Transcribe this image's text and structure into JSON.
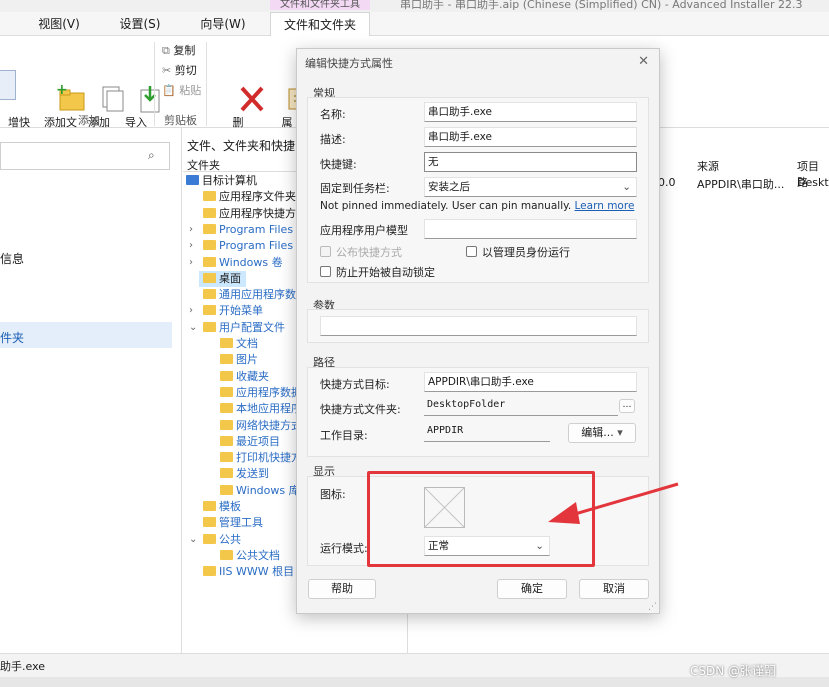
{
  "window": {
    "title": "串口助手 - 串口助手.aip (Chinese (Simplified) CN) - Advanced Installer 22.3",
    "context_tab_header": "文件和文件夹工具"
  },
  "menu": {
    "tabs": [
      "视图(V)",
      "设置(S)",
      "向导(W)",
      "文件和文件夹"
    ]
  },
  "ribbon": {
    "partial_left": "增快\n式·",
    "add_folder": "添加文\n件夹",
    "add_file": "添加\n文件",
    "import_file": "导入\n文件·",
    "group_add": "添加",
    "copy": "复制",
    "cut": "剪切",
    "paste": "粘贴",
    "group_clipboard": "剪贴板",
    "delete": "删\n除",
    "properties": "属\n性"
  },
  "left_pane": {
    "item_info": "信息",
    "item_files": "件夹"
  },
  "tree": {
    "header": "文件、文件夹和快捷",
    "col_folder": "文件夹",
    "items": [
      "目标计算机",
      "应用程序文件夹",
      "应用程序快捷方",
      "Program Files",
      "Program Files",
      "Windows 卷",
      "桌面",
      "通用应用程序数",
      "开始菜单",
      "用户配置文件",
      "文档",
      "图片",
      "收藏夹",
      "应用程序数据",
      "本地应用程序",
      "网络快捷方式",
      "最近项目",
      "打印机快捷方",
      "发送到",
      "Windows 库",
      "模板",
      "管理工具",
      "公共",
      "公共文档",
      "IIS WWW 根目"
    ]
  },
  "list": {
    "col_source": "来源",
    "col_project": "项目路",
    "row_partial": "0.0",
    "row_source": "APPDIR\\串口助...",
    "row_project": "Deskt"
  },
  "status": {
    "text": "助手.exe",
    "watermark": "CSDN @张谨嗣"
  },
  "dialog": {
    "title": "编辑快捷方式属性",
    "close": "✕",
    "general": {
      "heading": "常规",
      "name_label": "名称:",
      "name_value": "串口助手.exe",
      "desc_label": "描述:",
      "desc_value": "串口助手.exe",
      "hotkey_label": "快捷键:",
      "hotkey_value": "无",
      "pin_label": "固定到任务栏:",
      "pin_value": "安装之后",
      "pin_note": "Not pinned immediately. User can pin manually.",
      "learn_more": "Learn more",
      "app_model_label": "应用程序用户模型",
      "publish_label": "公布快捷方式",
      "admin_label": "以管理员身份运行",
      "prevent_pin_label": "防止开始被自动锁定"
    },
    "params": {
      "heading": "参数"
    },
    "path": {
      "heading": "路径",
      "target_label": "快捷方式目标:",
      "target_value": "APPDIR\\串口助手.exe",
      "folder_label": "快捷方式文件夹:",
      "folder_value": "DesktopFolder",
      "workdir_label": "工作目录:",
      "workdir_value": "APPDIR",
      "edit_button": "编辑..."
    },
    "display": {
      "heading": "显示",
      "icon_label": "图标:",
      "runmode_label": "运行模式:",
      "runmode_value": "正常"
    },
    "buttons": {
      "help": "帮助",
      "ok": "确定",
      "cancel": "取消"
    }
  },
  "colors": {
    "annotation": "#e2363c",
    "folder": "#f3c84a",
    "link": "#1a5fb4",
    "selection": "#cce8ff"
  }
}
